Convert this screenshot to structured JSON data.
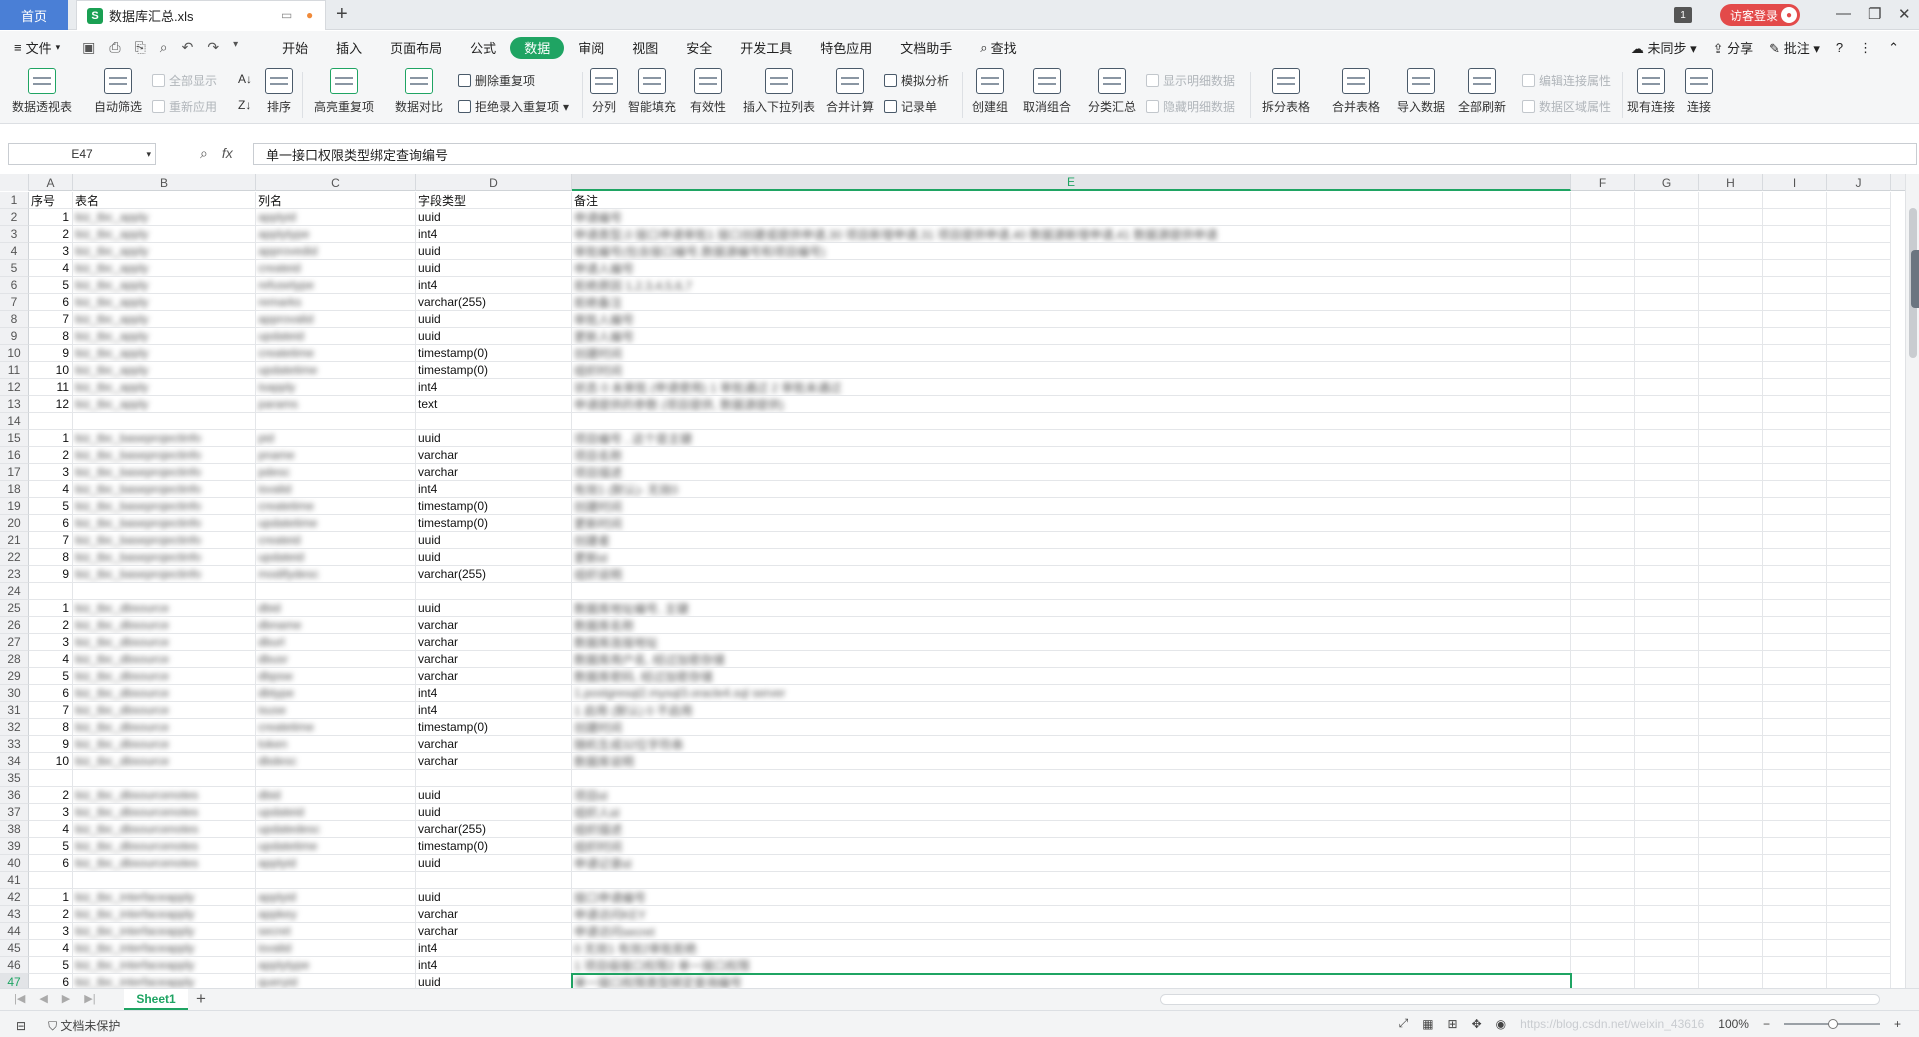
{
  "titlebar": {
    "home_tab": "首页",
    "file_tab": "数据库汇总.xls",
    "file_badge": "S",
    "window_badge": "1",
    "login_label": "访客登录"
  },
  "menubar": {
    "file_label": "文件",
    "items": [
      "开始",
      "插入",
      "页面布局",
      "公式",
      "数据",
      "审阅",
      "视图",
      "安全",
      "开发工具",
      "特色应用",
      "文档助手",
      "查找"
    ],
    "active_index": 4,
    "right": {
      "sync": "未同步",
      "share": "分享",
      "comment": "批注",
      "help": "?"
    }
  },
  "ribbon": {
    "pivot": "数据透视表",
    "autofilter": "自动筛选",
    "show_all": "全部显示",
    "reapply": "重新应用",
    "sort": "排序",
    "highlight_dup": "高亮重复项",
    "delete_dup": "删除重复项",
    "reject_dup": "拒绝录入重复项",
    "compare": "数据对比",
    "split": "分列",
    "smart_fill": "智能填充",
    "validity": "有效性",
    "insert_dropdown": "插入下拉列表",
    "consolidate": "合并计算",
    "what_if": "模拟分析",
    "record": "记录单",
    "group": "创建组",
    "ungroup": "取消组合",
    "subtotal": "分类汇总",
    "show_detail": "显示明细数据",
    "hide_detail": "隐藏明细数据",
    "split_table": "拆分表格",
    "merge_table": "合并表格",
    "import_data": "导入数据",
    "refresh_all": "全部刷新",
    "edit_conn": "编辑连接属性",
    "range_props": "数据区域属性",
    "existing_conn": "现有连接",
    "connect": "连接"
  },
  "formulabar": {
    "cell_ref": "E47",
    "fx": "fx",
    "value": "单一接口权限类型绑定查询编号"
  },
  "grid": {
    "columns": [
      "A",
      "B",
      "C",
      "D",
      "E",
      "F",
      "G",
      "H",
      "I",
      "J"
    ],
    "selected_column": "E",
    "selected_row": 47,
    "rows": [
      {
        "r": 1,
        "a": "序号",
        "b": "表名",
        "c": "列名",
        "d": "字段类型",
        "e": "备注",
        "hdr": true
      },
      {
        "r": 2,
        "a": "1",
        "b": "biz_tbc_apply",
        "c": "applyid",
        "d": "uuid",
        "e": "申请编号"
      },
      {
        "r": 3,
        "a": "2",
        "b": "biz_tbc_apply",
        "c": "applytype",
        "d": "int4",
        "e": "申请类型,0 接口申请审批1 接口创建或提供申请,30 项目新增申请,31 项目提供申请,40 数据源新增申请,41 数据源提供申请"
      },
      {
        "r": 4,
        "a": "3",
        "b": "biz_tbc_apply",
        "c": "approvedid",
        "d": "uuid",
        "e": "审批编号(包含接口编号,数据源编号和项目编号)"
      },
      {
        "r": 5,
        "a": "4",
        "b": "biz_tbc_apply",
        "c": "createid",
        "d": "uuid",
        "e": "申请人编号"
      },
      {
        "r": 6,
        "a": "5",
        "b": "biz_tbc_apply",
        "c": "refusetype",
        "d": "int4",
        "e": "拒绝原因 1,2,3,4,5,6,7"
      },
      {
        "r": 7,
        "a": "6",
        "b": "biz_tbc_apply",
        "c": "remarks",
        "d": "varchar(255)",
        "e": "拒绝备注"
      },
      {
        "r": 8,
        "a": "7",
        "b": "biz_tbc_apply",
        "c": "approvalid",
        "d": "uuid",
        "e": "审批人编号"
      },
      {
        "r": 9,
        "a": "8",
        "b": "biz_tbc_apply",
        "c": "updateid",
        "d": "uuid",
        "e": "更新人编号"
      },
      {
        "r": 10,
        "a": "9",
        "b": "biz_tbc_apply",
        "c": "createtime",
        "d": "timestamp(0)",
        "e": "创建时间"
      },
      {
        "r": 11,
        "a": "10",
        "b": "biz_tbc_apply",
        "c": "updatetime",
        "d": "timestamp(0)",
        "e": "组织时间"
      },
      {
        "r": 12,
        "a": "11",
        "b": "biz_tbc_apply",
        "c": "isapply",
        "d": "int4",
        "e": "状态 0 未审批 (申请使用) 1 审批通过 2 审批未通过"
      },
      {
        "r": 13,
        "a": "12",
        "b": "biz_tbc_apply",
        "c": "params",
        "d": "text",
        "e": "申请提供的参数 (项目提供, 数据源提供)"
      },
      {
        "r": 14,
        "a": "",
        "b": "",
        "c": "",
        "d": "",
        "e": ""
      },
      {
        "r": 15,
        "a": "1",
        "b": "biz_tbc_baseprojectinfo",
        "c": "pid",
        "d": "uuid",
        "e": "项目编号 , 这个是主键"
      },
      {
        "r": 16,
        "a": "2",
        "b": "biz_tbc_baseprojectinfo",
        "c": "pname",
        "d": "varchar",
        "e": "项目名称"
      },
      {
        "r": 17,
        "a": "3",
        "b": "biz_tbc_baseprojectinfo",
        "c": "pdesc",
        "d": "varchar",
        "e": "项目描述"
      },
      {
        "r": 18,
        "a": "4",
        "b": "biz_tbc_baseprojectinfo",
        "c": "isvalid",
        "d": "int4",
        "e": "有效1 (默认)- 无效0"
      },
      {
        "r": 19,
        "a": "5",
        "b": "biz_tbc_baseprojectinfo",
        "c": "createtime",
        "d": "timestamp(0)",
        "e": "创建时间"
      },
      {
        "r": 20,
        "a": "6",
        "b": "biz_tbc_baseprojectinfo",
        "c": "updatetime",
        "d": "timestamp(0)",
        "e": "更新时间"
      },
      {
        "r": 21,
        "a": "7",
        "b": "biz_tbc_baseprojectinfo",
        "c": "createid",
        "d": "uuid",
        "e": "创建者"
      },
      {
        "r": 22,
        "a": "8",
        "b": "biz_tbc_baseprojectinfo",
        "c": "updateid",
        "d": "uuid",
        "e": "更新id"
      },
      {
        "r": 23,
        "a": "9",
        "b": "biz_tbc_baseprojectinfo",
        "c": "modifydesc",
        "d": "varchar(255)",
        "e": "组织说明"
      },
      {
        "r": 24,
        "a": "",
        "b": "",
        "c": "",
        "d": "",
        "e": ""
      },
      {
        "r": 25,
        "a": "1",
        "b": "biz_tbc_dbsource",
        "c": "dbid",
        "d": "uuid",
        "e": "数据库地址编号, 主键"
      },
      {
        "r": 26,
        "a": "2",
        "b": "biz_tbc_dbsource",
        "c": "dbname",
        "d": "varchar",
        "e": "数据库名称"
      },
      {
        "r": 27,
        "a": "3",
        "b": "biz_tbc_dbsource",
        "c": "dburl",
        "d": "varchar",
        "e": "数据库连接地址"
      },
      {
        "r": 28,
        "a": "4",
        "b": "biz_tbc_dbsource",
        "c": "dbusr",
        "d": "varchar",
        "e": "数据库用户名, 经过加密存储"
      },
      {
        "r": 29,
        "a": "5",
        "b": "biz_tbc_dbsource",
        "c": "dbpsw",
        "d": "varchar",
        "e": "数据库密码, 经过加密存储"
      },
      {
        "r": 30,
        "a": "6",
        "b": "biz_tbc_dbsource",
        "c": "dbtype",
        "d": "int4",
        "e": "1.postgresql2.mysql3.oracle4.sql server"
      },
      {
        "r": 31,
        "a": "7",
        "b": "biz_tbc_dbsource",
        "c": "isuse",
        "d": "int4",
        "e": "1 启用 (默认) 0 不启用"
      },
      {
        "r": 32,
        "a": "8",
        "b": "biz_tbc_dbsource",
        "c": "createtime",
        "d": "timestamp(0)",
        "e": "创建时间"
      },
      {
        "r": 33,
        "a": "9",
        "b": "biz_tbc_dbsource",
        "c": "token",
        "d": "varchar",
        "e": "随机生成32位字符串"
      },
      {
        "r": 34,
        "a": "10",
        "b": "biz_tbc_dbsource",
        "c": "dbdesc",
        "d": "varchar",
        "e": "数据库说明"
      },
      {
        "r": 35,
        "a": "",
        "b": "",
        "c": "",
        "d": "",
        "e": ""
      },
      {
        "r": 36,
        "a": "2",
        "b": "biz_tbc_dbsourcenotes",
        "c": "dbid",
        "d": "uuid",
        "e": "项目id"
      },
      {
        "r": 37,
        "a": "3",
        "b": "biz_tbc_dbsourcenotes",
        "c": "updateid",
        "d": "uuid",
        "e": "组织人id"
      },
      {
        "r": 38,
        "a": "4",
        "b": "biz_tbc_dbsourcenotes",
        "c": "updatedesc",
        "d": "varchar(255)",
        "e": "组织描述"
      },
      {
        "r": 39,
        "a": "5",
        "b": "biz_tbc_dbsourcenotes",
        "c": "updatetime",
        "d": "timestamp(0)",
        "e": "组织时间"
      },
      {
        "r": 40,
        "a": "6",
        "b": "biz_tbc_dbsourcenotes",
        "c": "applyid",
        "d": "uuid",
        "e": "申请记录id"
      },
      {
        "r": 41,
        "a": "",
        "b": "",
        "c": "",
        "d": "",
        "e": ""
      },
      {
        "r": 42,
        "a": "1",
        "b": "biz_tbc_interfaceapply",
        "c": "applyid",
        "d": "uuid",
        "e": "接口申请编号"
      },
      {
        "r": 43,
        "a": "2",
        "b": "biz_tbc_interfaceapply",
        "c": "appkey",
        "d": "varchar",
        "e": "申请访问KEY"
      },
      {
        "r": 44,
        "a": "3",
        "b": "biz_tbc_interfaceapply",
        "c": "secret",
        "d": "varchar",
        "e": "申请访问secret"
      },
      {
        "r": 45,
        "a": "4",
        "b": "biz_tbc_interfaceapply",
        "c": "isvalid",
        "d": "int4",
        "e": "0 无效1 有效2审批拒绝"
      },
      {
        "r": 46,
        "a": "5",
        "b": "biz_tbc_interfaceapply",
        "c": "applytype",
        "d": "int4",
        "e": "1 项目级接口权限2 单一接口权限"
      },
      {
        "r": 47,
        "a": "6",
        "b": "biz_tbc_interfaceapply",
        "c": "queryid",
        "d": "uuid",
        "e": "单一接口权限类型绑定查询编号"
      }
    ]
  },
  "sheetbar": {
    "tab": "Sheet1",
    "add": "+"
  },
  "statusbar": {
    "protect": "文档未保护",
    "zoom": "100%",
    "watermark": "https://blog.csdn.net/weixin_43616"
  }
}
